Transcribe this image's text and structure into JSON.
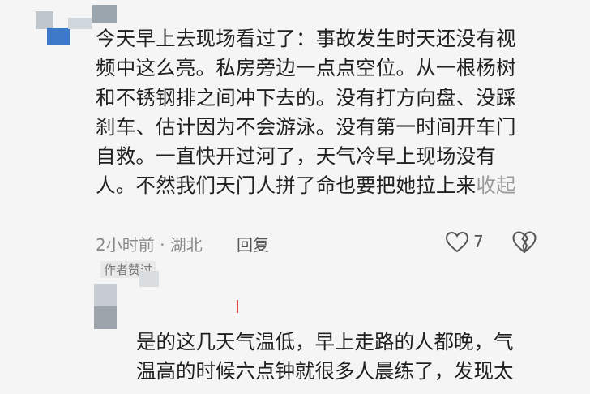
{
  "comment": {
    "lines": [
      "今天早上去现场看过了：事故发生时天还没有视",
      "频中这么亮。私房旁边一点点空位。从一根杨树",
      "和不锈钢排之间冲下去的。没有打方向盘、没踩",
      "刹车、估计因为不会游泳。没有第一时间开车门",
      "自救。一直快开过河了，天气冷早上现场没有",
      "人。不然我们天门人拼了命也要把她拉上来"
    ],
    "collapse_label": "收起",
    "time_location": "2小时前 · 湖北",
    "reply_label": "回复",
    "like_count": "7",
    "author_badge": "作者赞过"
  },
  "reply": {
    "lines": [
      "是的这几天气温低，早上走路的人都晚，气",
      "温高的时候六点钟就很多人晨练了，发现太"
    ]
  },
  "icons": {
    "like": "heart-outline-icon",
    "dislike": "broken-heart-icon"
  },
  "colors": {
    "background": "#f5f5f5",
    "text": "#202020",
    "secondary": "#8a8a8a"
  }
}
